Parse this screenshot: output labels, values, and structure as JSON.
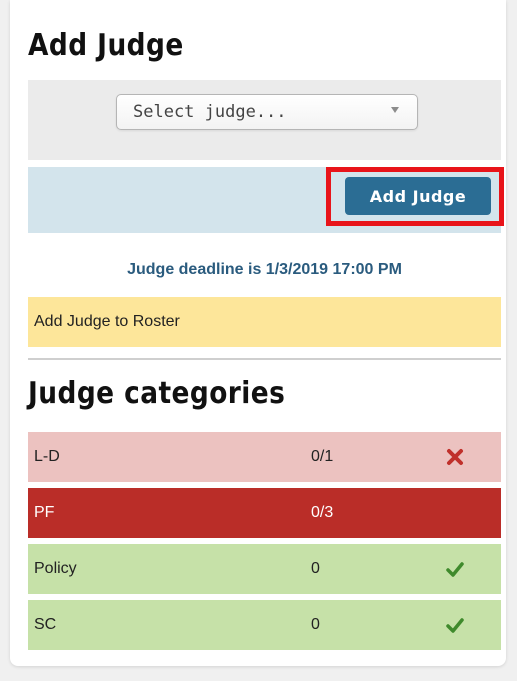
{
  "add_judge": {
    "title": "Add Judge",
    "select": {
      "placeholder": "Select judge..."
    },
    "button_label": "Add Judge",
    "deadline": "Judge deadline is 1/3/2019 17:00 PM",
    "roster_notice": "Add Judge to Roster"
  },
  "categories": {
    "title": "Judge categories",
    "rows": [
      {
        "name": "L-D",
        "count": "0/1",
        "status": "missing",
        "icon": "x-icon",
        "color": "#ecc2c0"
      },
      {
        "name": "PF",
        "count": "0/3",
        "status": "missing",
        "icon": "none",
        "color": "#ba2d28"
      },
      {
        "name": "Policy",
        "count": "0",
        "status": "ok",
        "icon": "check-icon",
        "color": "#c6e1a8"
      },
      {
        "name": "SC",
        "count": "0",
        "status": "ok",
        "icon": "check-icon",
        "color": "#c6e1a8"
      }
    ]
  },
  "colors": {
    "primary_button": "#2b6d94",
    "highlight_box": "#e8141a",
    "x_icon": "#c0302b",
    "check_icon": "#3f8a2c"
  }
}
